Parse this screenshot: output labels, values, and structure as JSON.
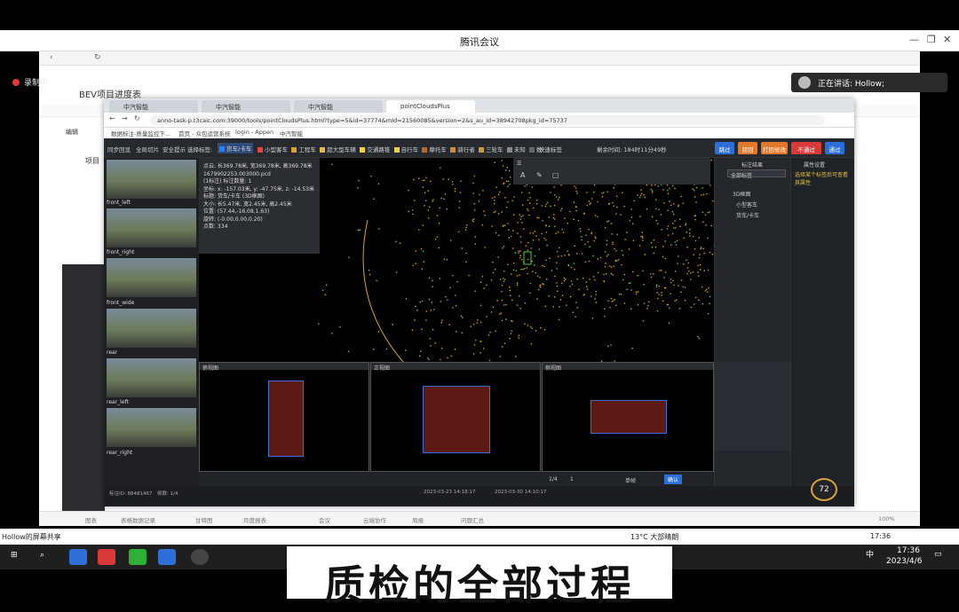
{
  "meeting": {
    "title": "腾讯会议",
    "recording": "录制中",
    "speaker": "正在讲话: Hollow;",
    "share_label": "Hollow的屏幕共享"
  },
  "bg_app": {
    "doc_title": "BEV项目进度表",
    "row_label": "项目",
    "col_label": "编辑"
  },
  "browser": {
    "tabs": [
      "中汽智能",
      "中汽智能",
      "中汽智能",
      "pointCloudsPlus"
    ],
    "url": "anno-task-p.t3caic.com:39000/tools/pointCloudsPlus.html?type=5&id=37774&mId=21560085&version=2&s_au_id=38942708pkg_id=75737",
    "bookmarks": [
      "数据标注-质量监控下...",
      "首页 - 众包运营系统",
      "login - Appen",
      "中汽智能"
    ]
  },
  "toolbar": {
    "items": [
      "同步回显",
      "全局切片",
      "安全提示",
      "选择标签:"
    ],
    "categories": [
      {
        "label": "货车/卡车",
        "color": "#2f7cf6"
      },
      {
        "label": "小型客车",
        "color": "#e04646"
      },
      {
        "label": "工程车",
        "color": "#e0a030"
      },
      {
        "label": "超大型车辆",
        "color": "#e6b84a"
      },
      {
        "label": "交通路锥",
        "color": "#f3d23a"
      },
      {
        "label": "自行车",
        "color": "#e8d44a"
      },
      {
        "label": "摩托车",
        "color": "#b06a2a"
      },
      {
        "label": "骑行者",
        "color": "#d78a3a"
      },
      {
        "label": "三轮车",
        "color": "#c99a3f"
      },
      {
        "label": "未知",
        "color": "#888888"
      },
      {
        "label": "数",
        "color": "#666666"
      }
    ],
    "more": "快速标签",
    "remaining": "剩余时间: 184时11分49秒",
    "buttons": [
      {
        "label": "跳过",
        "color": "#2d6fd6"
      },
      {
        "label": "驳回",
        "color": "#e07a2a"
      },
      {
        "label": "打回修改",
        "color": "#e07a2a"
      },
      {
        "label": "不通过",
        "color": "#d83a3a"
      },
      {
        "label": "通过",
        "color": "#2d6fd6"
      }
    ]
  },
  "cameras": [
    "front_left",
    "front_right",
    "front_wide",
    "rear",
    "rear_left",
    "rear_right"
  ],
  "info": [
    "点云: 长369.78米, 宽369.78米, 高369.78米",
    "1679902253.003000.pcd",
    "(1标注) 标注数量: 1",
    "坐标: x: -157.03米, y: -47.75米, z: -14.53米",
    "标题: 货车/卡车 (3D框图)",
    "大小: 长5.47米, 宽2.45米, 高2.45米",
    "位置: (57.44,-16.08,1.63)",
    "旋转: (-0.00,0.00,0.20)",
    "点数: 334"
  ],
  "right_panel": {
    "title": "标注结果",
    "filter": "全部标签",
    "tree": [
      "3D框图",
      "小型客车",
      "货车/卡车"
    ],
    "props_title": "属性设置",
    "note": "选择某个标签后可查看其属性"
  },
  "views": [
    "俯视图",
    "正视图",
    "侧视图"
  ],
  "bottom": {
    "page": "1/4",
    "frame": "1",
    "mode": "单帧",
    "confirm": "确认"
  },
  "status": {
    "id": "标注ID: 88481467",
    "frame": "帧数: 1/4",
    "time": "2023-03-23 14:18:17",
    "done": "2023-03-30 14:10:17"
  },
  "bg_toolbar": [
    "图表",
    "表格数据记录",
    "甘特图",
    "月度报表",
    "会议",
    "云端协作",
    "周报",
    "问题汇总"
  ],
  "zoom": "100%",
  "taskbar": {
    "weather": "13°C 大部晴朗",
    "time": "17:36",
    "date": "2023/4/6",
    "ime": "中"
  },
  "gauge": "72",
  "subtitle": "质检的全部过程"
}
